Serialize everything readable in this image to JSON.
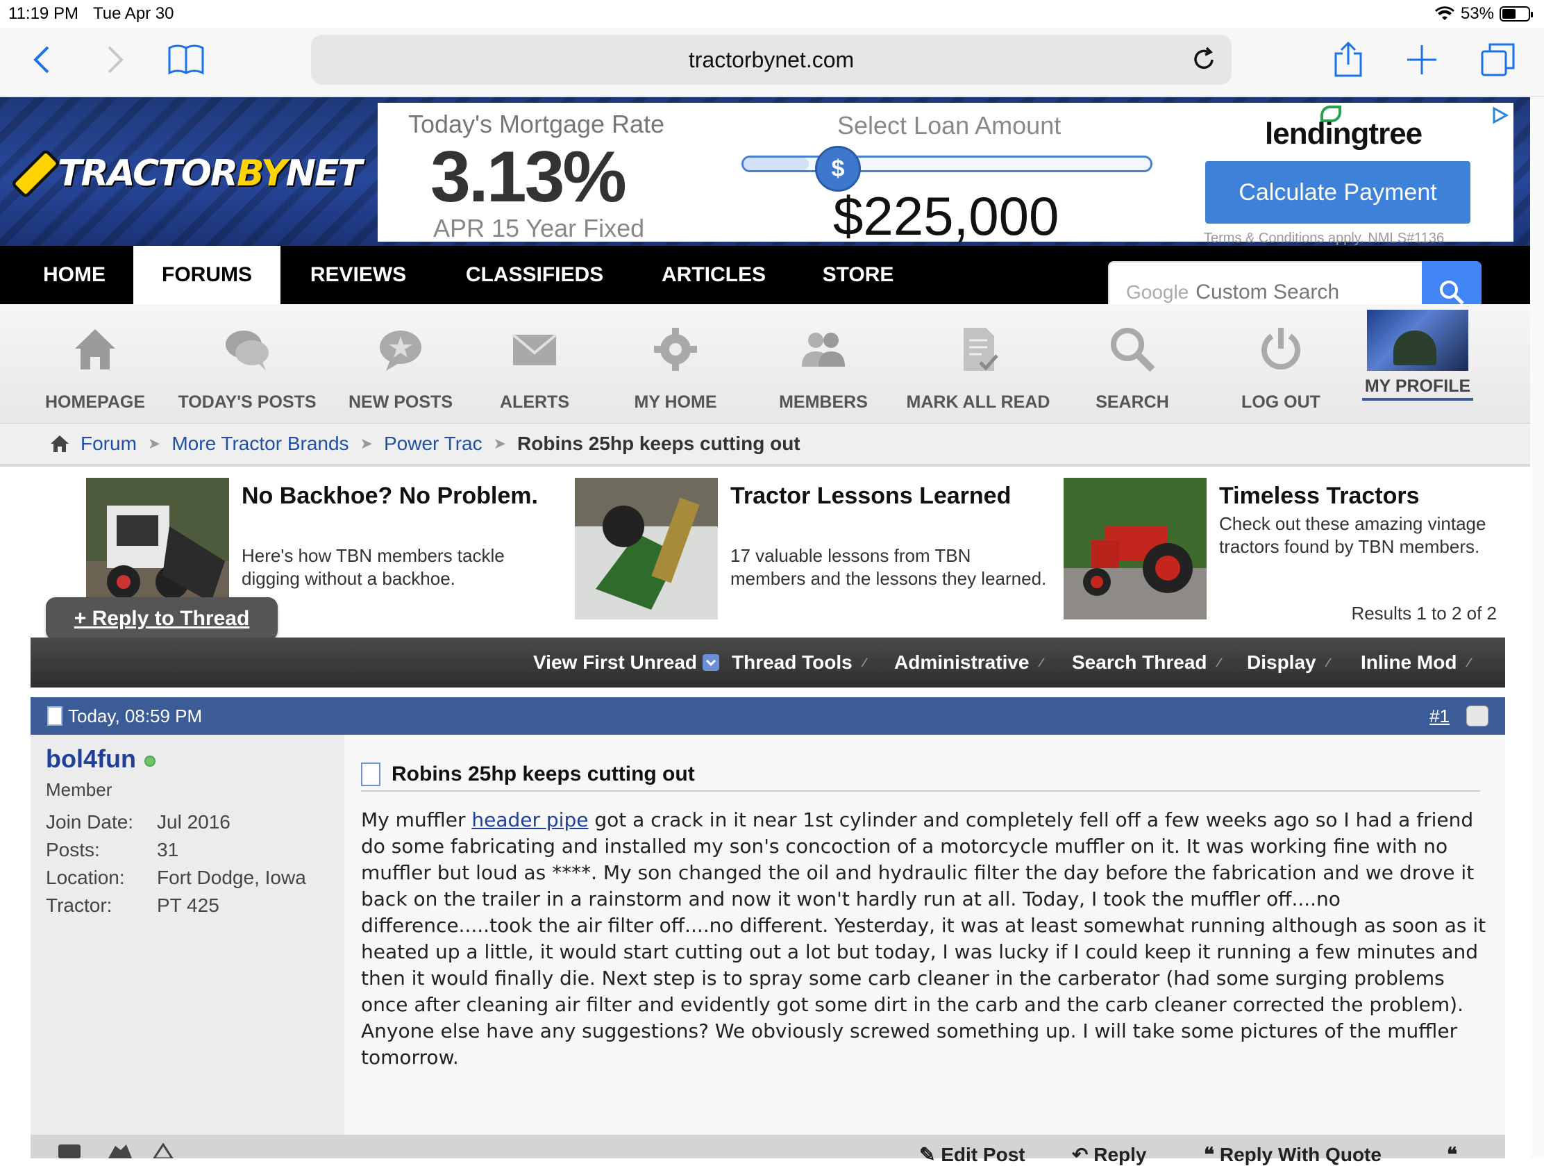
{
  "status_bar": {
    "time": "11:19 PM",
    "date": "Tue Apr 30",
    "battery": "53%",
    "battery_level": 0.53
  },
  "browser": {
    "url": "tractorbynet.com",
    "back_icon": "chevron-left-icon",
    "forward_icon": "chevron-right-icon",
    "bookmarks_icon": "book-icon",
    "reload_icon": "reload-icon",
    "share_icon": "share-icon",
    "new_tab_icon": "plus-icon",
    "tabs_icon": "tabs-icon",
    "accent_color": "#1a73e8"
  },
  "site": {
    "logo_primary": "TRACTOR",
    "logo_by": "BY",
    "logo_secondary": "NET"
  },
  "ad": {
    "rate_title": "Today's Mortgage Rate",
    "rate": "3.13%",
    "apr": "APR 15 Year Fixed",
    "loan_title": "Select Loan Amount",
    "slider_symbol": "$",
    "slider_level": 0.16,
    "amount": "$225,000",
    "brand": "lendingtree",
    "cta": "Calculate Payment",
    "terms": "Terms & Conditions apply. NMLS#1136"
  },
  "main_nav": {
    "tabs": [
      "HOME",
      "FORUMS",
      "REVIEWS",
      "CLASSIFIEDS",
      "ARTICLES",
      "STORE"
    ],
    "active": "FORUMS"
  },
  "search": {
    "google": "Google",
    "placeholder": "Custom Search"
  },
  "sub_nav": {
    "items": [
      "HOMEPAGE",
      "TODAY'S POSTS",
      "NEW POSTS",
      "ALERTS",
      "MY HOME",
      "MEMBERS",
      "MARK ALL READ",
      "SEARCH",
      "LOG OUT",
      "MY PROFILE"
    ]
  },
  "breadcrumb": {
    "items": [
      "Forum",
      "More Tractor Brands",
      "Power Trac"
    ],
    "current": "Robins 25hp keeps cutting out"
  },
  "promos": [
    {
      "title": "No Backhoe? No Problem.",
      "desc": "Here's how TBN members tackle digging without a backhoe."
    },
    {
      "title": "Tractor Lessons Learned",
      "desc": "17 valuable lessons from TBN members and the lessons they learned."
    },
    {
      "title": "Timeless Tractors",
      "desc": "Check out these amazing vintage tractors found by TBN members."
    }
  ],
  "reply_button": "+ Reply to Thread",
  "results": "Results 1 to 2 of 2",
  "toolbar": [
    "View First Unread",
    "Thread Tools",
    "Administrative",
    "Search Thread",
    "Display",
    "Inline Mod"
  ],
  "post": {
    "date": "Today, 08:59 PM",
    "number": "#1",
    "user": {
      "name": "bol4fun",
      "title": "Member",
      "info": [
        {
          "k": "Join Date:",
          "v": "Jul 2016"
        },
        {
          "k": "Posts:",
          "v": "31"
        },
        {
          "k": "Location:",
          "v": "Fort Dodge, Iowa"
        },
        {
          "k": "Tractor:",
          "v": "PT 425"
        }
      ]
    },
    "title": "Robins 25hp keeps cutting out",
    "text_before_link": "My muffler ",
    "link": "header pipe",
    "text_after_link": " got a crack in it near 1st cylinder and completely fell off a few weeks ago so I had a friend do some fabricating and installed my son's concoction of a motorcycle muffler on it. It was working fine with no muffler but loud as ****. My son changed the oil and hydraulic filter the day before the fabrication and we drove it back on the trailer in a rainstorm and now it won't hardly run at all. Today, I took the muffler off....no difference.....took the air filter off....no different. Yesterday, it was at least somewhat running although as soon as it heated up a little, it would start cutting out a lot but today, I was lucky if I could keep it running a few minutes and then it would finally die. Next step is to spray some carb cleaner in the carberator (had some surging problems once after cleaning air filter and evidently got some dirt in the carb and the carb cleaner corrected the problem).",
    "text_second": "Anyone else have any suggestions? We obviously screwed something up. I will take some pictures of the muffler tomorrow."
  },
  "post_footer": [
    "Edit Post",
    "Reply",
    "Reply With Quote"
  ]
}
